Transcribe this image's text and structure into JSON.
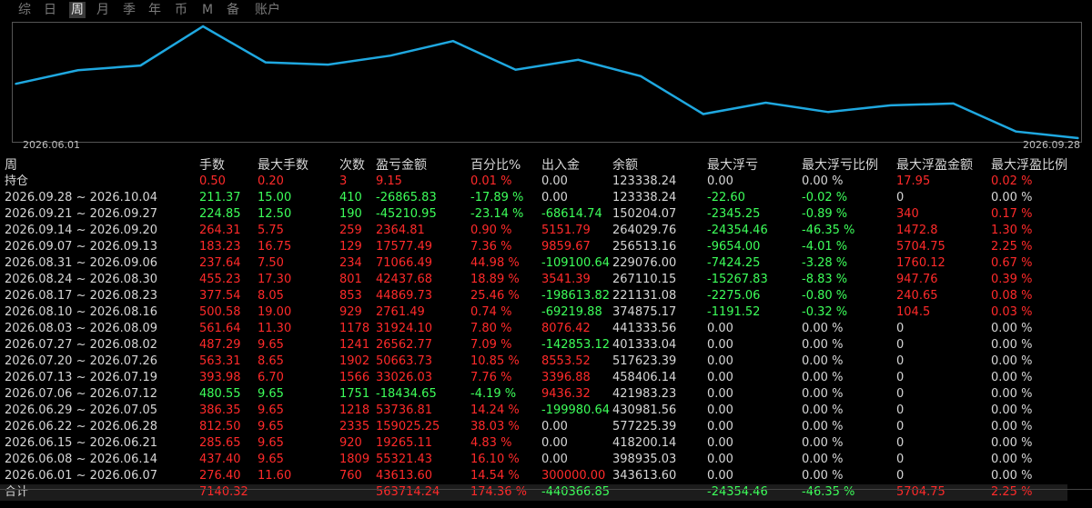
{
  "tabs": [
    "综",
    "日",
    "周",
    "月",
    "季",
    "年",
    "币",
    "M",
    "备",
    "账户"
  ],
  "active_tab": "周",
  "chart_data": {
    "type": "line",
    "x_labels": [
      "2026.06.01",
      "2026.09.28"
    ],
    "x": [
      "2026.06.01",
      "2026.06.08",
      "2026.06.15",
      "2026.06.22",
      "2026.06.29",
      "2026.07.06",
      "2026.07.13",
      "2026.07.20",
      "2026.07.27",
      "2026.08.03",
      "2026.08.10",
      "2026.08.17",
      "2026.08.24",
      "2026.08.31",
      "2026.09.07",
      "2026.09.14",
      "2026.09.21",
      "2026.09.28"
    ],
    "values": [
      343613.6,
      398935.03,
      418200.14,
      577225.39,
      430981.56,
      421983.23,
      458406.14,
      517623.39,
      401333.04,
      441333.56,
      374875.17,
      221131.08,
      267110.15,
      229076.0,
      256513.16,
      264029.76,
      150204.07,
      123338.24
    ],
    "note_color": "#1fa8e0"
  },
  "headers": [
    "周",
    "手数",
    "最大手数",
    "次数",
    "盈亏金额",
    "百分比%",
    "出入金",
    "余额",
    "最大浮亏",
    "最大浮亏比例",
    "最大浮盈金额",
    "最大浮盈比例"
  ],
  "rows": [
    {
      "c": [
        "持仓",
        "0.50",
        "0.20",
        "3",
        "9.15",
        "0.01 %",
        "0.00",
        "123338.24",
        "0.00",
        "0.00 %",
        "17.95",
        "0.02 %"
      ],
      "k": [
        "w",
        "r",
        "r",
        "r",
        "r",
        "r",
        "w",
        "w",
        "w",
        "w",
        "r",
        "r"
      ]
    },
    {
      "c": [
        "2026.09.28 ~ 2026.10.04",
        "211.37",
        "15.00",
        "410",
        "-26865.83",
        "-17.89 %",
        "0.00",
        "123338.24",
        "-22.60",
        "-0.02 %",
        "0",
        "0.00 %"
      ],
      "k": [
        "w",
        "g",
        "g",
        "g",
        "g",
        "g",
        "w",
        "w",
        "g",
        "g",
        "w",
        "w"
      ]
    },
    {
      "c": [
        "2026.09.21 ~ 2026.09.27",
        "224.85",
        "12.50",
        "190",
        "-45210.95",
        "-23.14 %",
        "-68614.74",
        "150204.07",
        "-2345.25",
        "-0.89 %",
        "340",
        "0.17 %"
      ],
      "k": [
        "w",
        "g",
        "g",
        "g",
        "g",
        "g",
        "g",
        "w",
        "g",
        "g",
        "r",
        "r"
      ]
    },
    {
      "c": [
        "2026.09.14 ~ 2026.09.20",
        "264.31",
        "5.75",
        "259",
        "2364.81",
        "0.90 %",
        "5151.79",
        "264029.76",
        "-24354.46",
        "-46.35 %",
        "1472.8",
        "1.30 %"
      ],
      "k": [
        "w",
        "r",
        "r",
        "r",
        "r",
        "r",
        "r",
        "w",
        "g",
        "g",
        "r",
        "r"
      ]
    },
    {
      "c": [
        "2026.09.07 ~ 2026.09.13",
        "183.23",
        "16.75",
        "129",
        "17577.49",
        "7.36 %",
        "9859.67",
        "256513.16",
        "-9654.00",
        "-4.01 %",
        "5704.75",
        "2.25 %"
      ],
      "k": [
        "w",
        "r",
        "r",
        "r",
        "r",
        "r",
        "r",
        "w",
        "g",
        "g",
        "r",
        "r"
      ]
    },
    {
      "c": [
        "2026.08.31 ~ 2026.09.06",
        "237.64",
        "7.50",
        "234",
        "71066.49",
        "44.98 %",
        "-109100.64",
        "229076.00",
        "-7424.25",
        "-3.28 %",
        "1760.12",
        "0.67 %"
      ],
      "k": [
        "w",
        "r",
        "r",
        "r",
        "r",
        "r",
        "g",
        "w",
        "g",
        "g",
        "r",
        "r"
      ]
    },
    {
      "c": [
        "2026.08.24 ~ 2026.08.30",
        "455.23",
        "17.30",
        "801",
        "42437.68",
        "18.89 %",
        "3541.39",
        "267110.15",
        "-15267.83",
        "-8.83 %",
        "947.76",
        "0.39 %"
      ],
      "k": [
        "w",
        "r",
        "r",
        "r",
        "r",
        "r",
        "r",
        "w",
        "g",
        "g",
        "r",
        "r"
      ]
    },
    {
      "c": [
        "2026.08.17 ~ 2026.08.23",
        "377.54",
        "8.05",
        "853",
        "44869.73",
        "25.46 %",
        "-198613.82",
        "221131.08",
        "-2275.06",
        "-0.80 %",
        "240.65",
        "0.08 %"
      ],
      "k": [
        "w",
        "r",
        "r",
        "r",
        "r",
        "r",
        "g",
        "w",
        "g",
        "g",
        "r",
        "r"
      ]
    },
    {
      "c": [
        "2026.08.10 ~ 2026.08.16",
        "500.58",
        "19.00",
        "929",
        "2761.49",
        "0.74 %",
        "-69219.88",
        "374875.17",
        "-1191.52",
        "-0.32 %",
        "104.5",
        "0.03 %"
      ],
      "k": [
        "w",
        "r",
        "r",
        "r",
        "r",
        "r",
        "g",
        "w",
        "g",
        "g",
        "r",
        "r"
      ]
    },
    {
      "c": [
        "2026.08.03 ~ 2026.08.09",
        "561.64",
        "11.30",
        "1178",
        "31924.10",
        "7.80 %",
        "8076.42",
        "441333.56",
        "0.00",
        "0.00 %",
        "0",
        "0.00 %"
      ],
      "k": [
        "w",
        "r",
        "r",
        "r",
        "r",
        "r",
        "r",
        "w",
        "w",
        "w",
        "w",
        "w"
      ]
    },
    {
      "c": [
        "2026.07.27 ~ 2026.08.02",
        "487.29",
        "9.65",
        "1241",
        "26562.77",
        "7.09 %",
        "-142853.12",
        "401333.04",
        "0.00",
        "0.00 %",
        "0",
        "0.00 %"
      ],
      "k": [
        "w",
        "r",
        "r",
        "r",
        "r",
        "r",
        "g",
        "w",
        "w",
        "w",
        "w",
        "w"
      ]
    },
    {
      "c": [
        "2026.07.20 ~ 2026.07.26",
        "563.31",
        "8.65",
        "1902",
        "50663.73",
        "10.85 %",
        "8553.52",
        "517623.39",
        "0.00",
        "0.00 %",
        "0",
        "0.00 %"
      ],
      "k": [
        "w",
        "r",
        "r",
        "r",
        "r",
        "r",
        "r",
        "w",
        "w",
        "w",
        "w",
        "w"
      ]
    },
    {
      "c": [
        "2026.07.13 ~ 2026.07.19",
        "393.98",
        "6.70",
        "1566",
        "33026.03",
        "7.76 %",
        "3396.88",
        "458406.14",
        "0.00",
        "0.00 %",
        "0",
        "0.00 %"
      ],
      "k": [
        "w",
        "r",
        "r",
        "r",
        "r",
        "r",
        "r",
        "w",
        "w",
        "w",
        "w",
        "w"
      ]
    },
    {
      "c": [
        "2026.07.06 ~ 2026.07.12",
        "480.55",
        "9.65",
        "1751",
        "-18434.65",
        "-4.19 %",
        "9436.32",
        "421983.23",
        "0.00",
        "0.00 %",
        "0",
        "0.00 %"
      ],
      "k": [
        "w",
        "g",
        "g",
        "g",
        "g",
        "g",
        "r",
        "w",
        "w",
        "w",
        "w",
        "w"
      ]
    },
    {
      "c": [
        "2026.06.29 ~ 2026.07.05",
        "386.35",
        "9.65",
        "1218",
        "53736.81",
        "14.24 %",
        "-199980.64",
        "430981.56",
        "0.00",
        "0.00 %",
        "0",
        "0.00 %"
      ],
      "k": [
        "w",
        "r",
        "r",
        "r",
        "r",
        "r",
        "g",
        "w",
        "w",
        "w",
        "w",
        "w"
      ]
    },
    {
      "c": [
        "2026.06.22 ~ 2026.06.28",
        "812.50",
        "9.65",
        "2335",
        "159025.25",
        "38.03 %",
        "0.00",
        "577225.39",
        "0.00",
        "0.00 %",
        "0",
        "0.00 %"
      ],
      "k": [
        "w",
        "r",
        "r",
        "r",
        "r",
        "r",
        "w",
        "w",
        "w",
        "w",
        "w",
        "w"
      ]
    },
    {
      "c": [
        "2026.06.15 ~ 2026.06.21",
        "285.65",
        "9.65",
        "920",
        "19265.11",
        "4.83 %",
        "0.00",
        "418200.14",
        "0.00",
        "0.00 %",
        "0",
        "0.00 %"
      ],
      "k": [
        "w",
        "r",
        "r",
        "r",
        "r",
        "r",
        "w",
        "w",
        "w",
        "w",
        "w",
        "w"
      ]
    },
    {
      "c": [
        "2026.06.08 ~ 2026.06.14",
        "437.40",
        "9.65",
        "1809",
        "55321.43",
        "16.10 %",
        "0.00",
        "398935.03",
        "0.00",
        "0.00 %",
        "0",
        "0.00 %"
      ],
      "k": [
        "w",
        "r",
        "r",
        "r",
        "r",
        "r",
        "w",
        "w",
        "w",
        "w",
        "w",
        "w"
      ]
    },
    {
      "c": [
        "2026.06.01 ~ 2026.06.07",
        "276.40",
        "11.60",
        "760",
        "43613.60",
        "14.54 %",
        "300000.00",
        "343613.60",
        "0.00",
        "0.00 %",
        "0",
        "0.00 %"
      ],
      "k": [
        "w",
        "r",
        "r",
        "r",
        "r",
        "r",
        "r",
        "w",
        "w",
        "w",
        "w",
        "w"
      ]
    }
  ],
  "total": {
    "c": [
      "合计",
      "7140.32",
      "",
      "",
      "563714.24",
      "174.36 %",
      "-440366.85",
      "",
      "-24354.46",
      "-46.35 %",
      "5704.75",
      "2.25 %"
    ],
    "k": [
      "w",
      "r",
      "w",
      "w",
      "r",
      "r",
      "g",
      "w",
      "g",
      "g",
      "r",
      "r"
    ]
  }
}
